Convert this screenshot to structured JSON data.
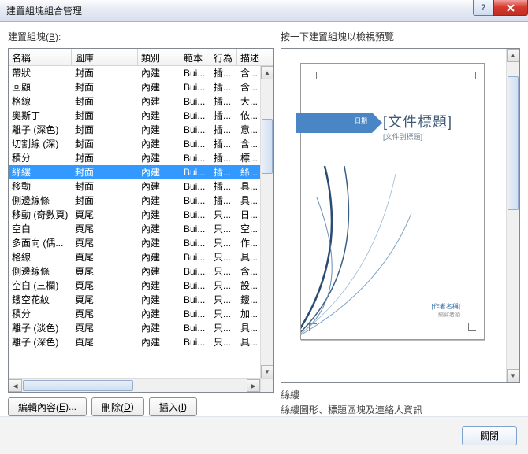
{
  "title": "建置組塊組合管理",
  "left_label_html": "建置組塊(B):",
  "right_label": "按一下建置組塊以檢視預覽",
  "columns": [
    "名稱",
    "圖庫",
    "類別",
    "範本",
    "行為",
    "描述"
  ],
  "rows": [
    {
      "c": [
        "帶狀",
        "封面",
        "內建",
        "Bui...",
        "插...",
        "含..."
      ],
      "sel": false
    },
    {
      "c": [
        "回顧",
        "封面",
        "內建",
        "Bui...",
        "插...",
        "含..."
      ],
      "sel": false
    },
    {
      "c": [
        "格線",
        "封面",
        "內建",
        "Bui...",
        "插...",
        "大..."
      ],
      "sel": false
    },
    {
      "c": [
        "奧斯丁",
        "封面",
        "內建",
        "Bui...",
        "插...",
        "依..."
      ],
      "sel": false
    },
    {
      "c": [
        "離子 (深色)",
        "封面",
        "內建",
        "Bui...",
        "插...",
        "意..."
      ],
      "sel": false
    },
    {
      "c": [
        "切割線 (深)",
        "封面",
        "內建",
        "Bui...",
        "插...",
        "含..."
      ],
      "sel": false
    },
    {
      "c": [
        "積分",
        "封面",
        "內建",
        "Bui...",
        "插...",
        "標..."
      ],
      "sel": false
    },
    {
      "c": [
        "絲縷",
        "封面",
        "內建",
        "Bui...",
        "插...",
        "絲..."
      ],
      "sel": true
    },
    {
      "c": [
        "移動",
        "封面",
        "內建",
        "Bui...",
        "插...",
        "具..."
      ],
      "sel": false
    },
    {
      "c": [
        "側邊線條",
        "封面",
        "內建",
        "Bui...",
        "插...",
        "具..."
      ],
      "sel": false
    },
    {
      "c": [
        "移動 (奇數頁)",
        "頁尾",
        "內建",
        "Bui...",
        "只...",
        "日..."
      ],
      "sel": false
    },
    {
      "c": [
        "空白",
        "頁尾",
        "內建",
        "Bui...",
        "只...",
        "空..."
      ],
      "sel": false
    },
    {
      "c": [
        "多面向 (偶...",
        "頁尾",
        "內建",
        "Bui...",
        "只...",
        "作..."
      ],
      "sel": false
    },
    {
      "c": [
        "格線",
        "頁尾",
        "內建",
        "Bui...",
        "只...",
        "具..."
      ],
      "sel": false
    },
    {
      "c": [
        "側邊線條",
        "頁尾",
        "內建",
        "Bui...",
        "只...",
        "含..."
      ],
      "sel": false
    },
    {
      "c": [
        "空白 (三欄)",
        "頁尾",
        "內建",
        "Bui...",
        "只...",
        "設..."
      ],
      "sel": false
    },
    {
      "c": [
        "鏤空花紋",
        "頁尾",
        "內建",
        "Bui...",
        "只...",
        "鏤..."
      ],
      "sel": false
    },
    {
      "c": [
        "積分",
        "頁尾",
        "內建",
        "Bui...",
        "只...",
        "加..."
      ],
      "sel": false
    },
    {
      "c": [
        "離子 (淡色)",
        "頁尾",
        "內建",
        "Bui...",
        "只...",
        "具..."
      ],
      "sel": false
    },
    {
      "c": [
        "離子 (深色)",
        "頁尾",
        "內建",
        "Bui...",
        "只...",
        "具..."
      ],
      "sel": false
    }
  ],
  "buttons": {
    "edit": "編輯內容(E)...",
    "delete": "刪除(D)",
    "insert": "插入(I)"
  },
  "preview": {
    "ribbon_label": "日期",
    "doc_title": "[文件標題]",
    "doc_subtitle": "[文件副標題]",
    "author_line1": "[作者名稱]",
    "author_line2": "編寫者頭",
    "name": "絲縷",
    "desc": "絲縷圖形、標題區塊及連絡人資訊"
  },
  "footer": {
    "close": "關閉"
  }
}
